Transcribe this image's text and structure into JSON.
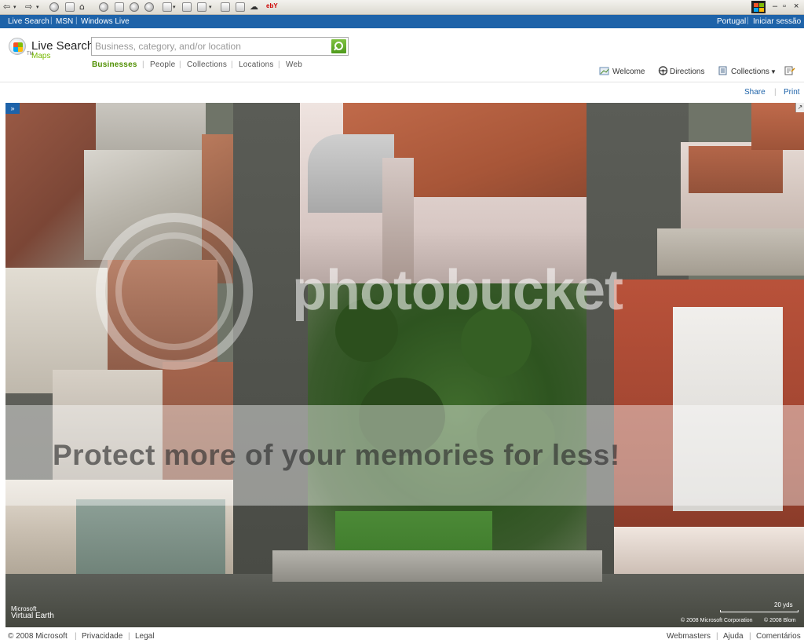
{
  "browser_toolbar": {
    "icons": [
      "back-arrow-icon",
      "forward-arrow-icon",
      "stop-icon",
      "refresh-icon",
      "home-icon",
      "search-icon",
      "favorites-icon",
      "history-icon",
      "mail-icon",
      "print-icon",
      "edit-icon",
      "discuss-icon",
      "messenger-icon",
      "research-icon"
    ],
    "ebay_label": "ebY",
    "window_controls": [
      "–",
      "▫",
      "×"
    ]
  },
  "top_bar": {
    "left_links": [
      "Live Search",
      "MSN",
      "Windows Live"
    ],
    "right_links": [
      "Portugal",
      "Iniciar sessão"
    ]
  },
  "logo": {
    "name": "Live Search",
    "tm": "TM",
    "sub": "Maps"
  },
  "search": {
    "placeholder": "Business, category, and/or location",
    "value": ""
  },
  "tabs": [
    {
      "label": "Businesses",
      "active": true
    },
    {
      "label": "People",
      "active": false
    },
    {
      "label": "Collections",
      "active": false
    },
    {
      "label": "Locations",
      "active": false
    },
    {
      "label": "Web",
      "active": false
    }
  ],
  "right_toolbar": {
    "welcome": "Welcome",
    "directions": "Directions",
    "collections": "Collections"
  },
  "map_actions": {
    "share": "Share",
    "print": "Print"
  },
  "map": {
    "toggle_label": "»",
    "brand_line1": "Microsoft",
    "brand_line2": "Virtual Earth",
    "scale": "20 yds",
    "copyright1": "© 2008 Microsoft Corporation",
    "copyright2": "© 2008 Blom",
    "watermark_brand": "photobucket",
    "watermark_tagline": "Protect more of your memories for less!"
  },
  "footer": {
    "left": [
      "© 2008 Microsoft",
      "Privacidade",
      "Legal"
    ],
    "right": [
      "Webmasters",
      "Ajuda",
      "Comentários"
    ]
  },
  "colors": {
    "brand_blue": "#1e63a9",
    "active_tab_green": "#4f8f00",
    "search_button_green": "#5fa82a"
  }
}
